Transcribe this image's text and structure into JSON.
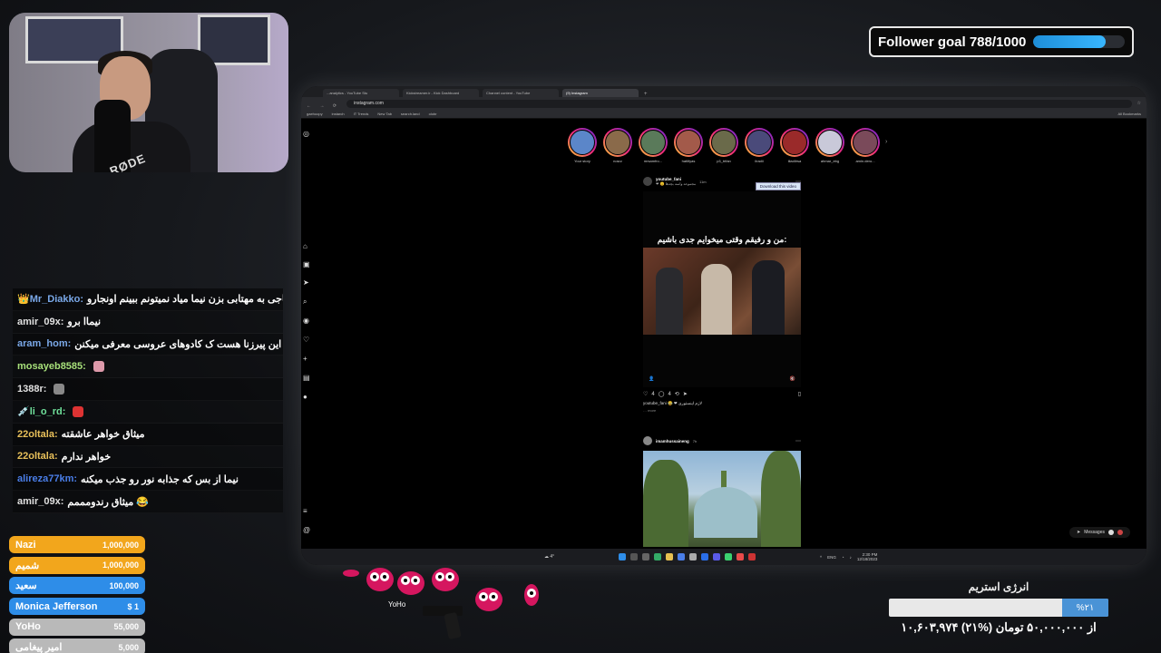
{
  "follower_goal": {
    "label": "Follower goal 788/1000",
    "current": 788,
    "target": 1000,
    "progress": 0.788
  },
  "webcam": {
    "mic_brand": "RØDE"
  },
  "browser": {
    "tabs": [
      {
        "label": "...analytics - YouTube Stu",
        "active": false
      },
      {
        "label": "Kickstreamer.ir - Kick Dashboard",
        "active": false
      },
      {
        "label": "Channel content - YouTube",
        "active": false
      },
      {
        "label": "(9) Instagram",
        "active": true
      }
    ],
    "url": "instagram.com",
    "bookmarks": [
      "gaehoopy",
      "instarch",
      "IT Trends",
      "New Tab",
      "search.land",
      "olobr",
      "All Bookmarks"
    ]
  },
  "instagram": {
    "stories": [
      {
        "name": "Your story"
      },
      {
        "name": "nosrz"
      },
      {
        "name": "mrsamfro..."
      },
      {
        "name": "hatlifyas"
      },
      {
        "name": "p3_trifan"
      },
      {
        "name": "ilradii"
      },
      {
        "name": "iliadilrsa"
      },
      {
        "name": "ahmar_ebg"
      },
      {
        "name": "amin.dero..."
      }
    ],
    "post1": {
      "username": "youtube_fani",
      "time": "11m",
      "subtitle": "❤ 😊 مجموعه واسه بچه‌ها",
      "download_button": "Download this video",
      "video_caption": "من و رفیقم وقتی میخوایم جدی باشیم:",
      "likes": "4",
      "comments": "4",
      "caption": "youtube_fani 😂 ❤ لازم اینستوری",
      "more": "… more"
    },
    "post2": {
      "username": "imamhussaineng",
      "time": "7h"
    },
    "messages_label": "Messages"
  },
  "taskbar": {
    "weather": "4°",
    "lang": "ENG",
    "time": "2:30 PM",
    "date": "12/18/2023"
  },
  "chat": [
    {
      "user": "👑Mr_Diakko:",
      "user_color": "#7aa8e8",
      "message": "حاجی به مهتابی بزن نیما میاد نمیتونم ببینم اونجارو",
      "emote": ""
    },
    {
      "user": "amir_09x:",
      "user_color": "#e0e0e0",
      "message": "نیماا برو",
      "emote": ""
    },
    {
      "user": "aram_hom:",
      "user_color": "#7aa8e8",
      "message": "نیما انگار این پیرزنا هست ک کادوهای عروسی معرفی میکنن",
      "emote": ""
    },
    {
      "user": "mosayeb8585:",
      "user_color": "#a7e07a",
      "message": "",
      "emote": "#d9a"
    },
    {
      "user": "1388r:",
      "user_color": "#e0e0e0",
      "message": "",
      "emote": "#888"
    },
    {
      "user": "💉li_o_rd:",
      "user_color": "#6fe09a",
      "message": "",
      "emote": "#d33"
    },
    {
      "user": "22oltala:",
      "user_color": "#e8c05a",
      "message": "میثاق خواهر عاشقته",
      "emote": ""
    },
    {
      "user": "22oltala:",
      "user_color": "#e8c05a",
      "message": "خواهر ندارم",
      "emote": ""
    },
    {
      "user": "alireza77km:",
      "user_color": "#4a7ee8",
      "message": "نیما از بس که جذابه نور رو جذب میکنه",
      "emote": ""
    },
    {
      "user": "amir_09x:",
      "user_color": "#e0e0e0",
      "message": "میثاق رندومممم 😂",
      "emote": ""
    }
  ],
  "donations": [
    {
      "name": "Nazi",
      "amount": "1,000,000",
      "color": "#f2a61c"
    },
    {
      "name": "شمیم",
      "amount": "1,000,000",
      "color": "#f2a61c"
    },
    {
      "name": "سعید",
      "amount": "100,000",
      "color": "#2e8de8"
    },
    {
      "name": "Monica Jefferson",
      "amount": "$ 1",
      "color": "#2e8de8"
    },
    {
      "name": "YoHo",
      "amount": "55,000",
      "color": "#b9b9b9"
    },
    {
      "name": "امیر پیغامی",
      "amount": "5,000",
      "color": "#b9b9b9"
    }
  ],
  "emotes": {
    "label": "YoHo"
  },
  "energy": {
    "title": "انرژی استریم",
    "percent_label": "%۲۱",
    "progress": 0.21,
    "amount": "۱۰,۶۰۳,۹۷۴ از ۵۰,۰۰۰,۰۰۰ تومان (%۲۱)"
  }
}
